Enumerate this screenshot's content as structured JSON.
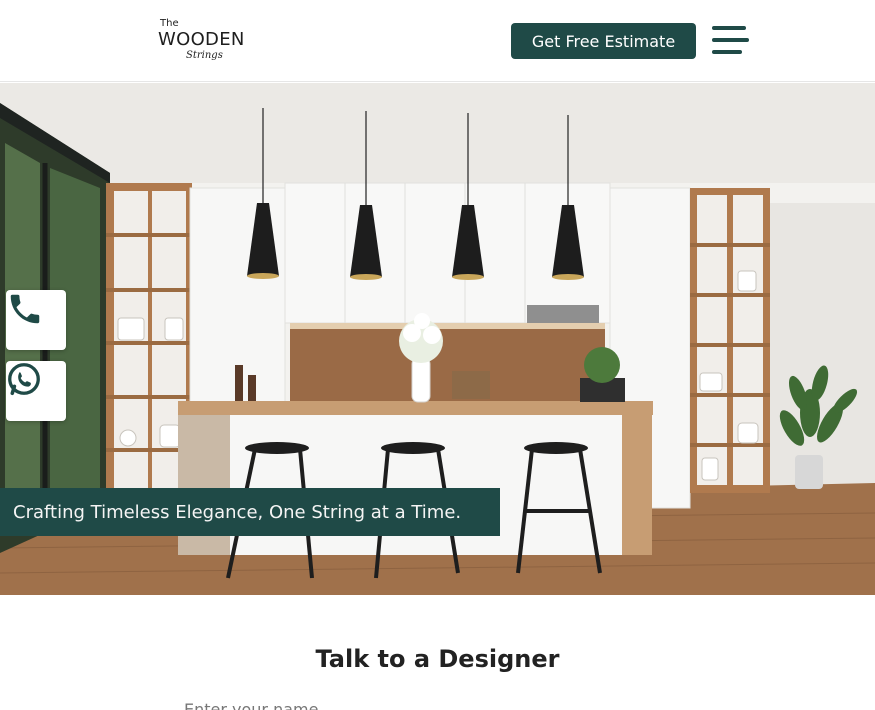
{
  "header": {
    "logo": {
      "line1": "The",
      "line2": "WOODEN",
      "line3": "Strings"
    },
    "cta_label": "Get Free Estimate"
  },
  "hero": {
    "tagline": "Crafting Timeless Elegance, One String at a Time.",
    "float_buttons": [
      "phone-icon",
      "whatsapp-icon"
    ]
  },
  "form": {
    "title": "Talk to a Designer",
    "name_placeholder": "Enter your name"
  },
  "colors": {
    "brand": "#1f4a47",
    "background": "#ffffff"
  }
}
